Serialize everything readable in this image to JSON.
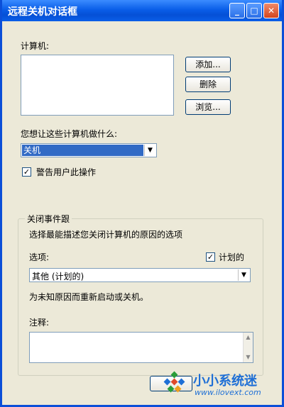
{
  "window": {
    "title": "远程关机对话框"
  },
  "titlebar_buttons": {
    "minimize": "_",
    "maximize": "□",
    "close": "✕"
  },
  "computers": {
    "label": "计算机:",
    "add_label": "添加...",
    "remove_label": "删除",
    "browse_label": "浏览..."
  },
  "action": {
    "label": "您想让这些计算机做什么:",
    "selected": "关机"
  },
  "warn": {
    "label": "警告用户此操作",
    "checked": true
  },
  "shutdown_tracker": {
    "title": "关闭事件跟",
    "description": "选择最能描述您关闭计算机的原因的选项",
    "option_label": "选项:",
    "planned_label": "计划的",
    "planned_checked": true,
    "option_selected": "其他 (计划的)",
    "reason_text": "为未知原因而重新启动或关机。",
    "comment_label": "注释:"
  },
  "watermark": {
    "name": "小小系统迷",
    "url": "www.ilovext.com"
  }
}
